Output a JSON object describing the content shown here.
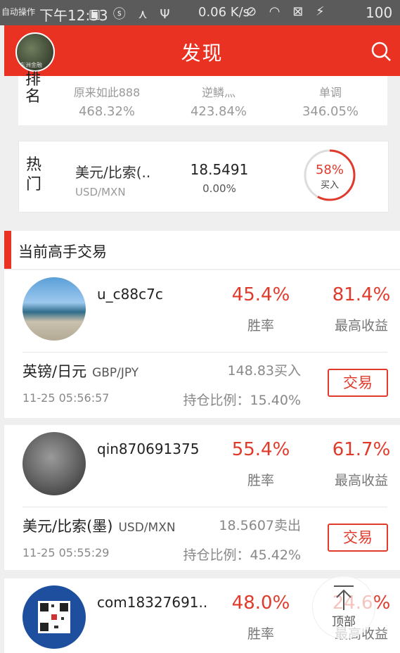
{
  "status_bar": {
    "left_text": "自动操作",
    "time": "下午12:53",
    "network_speed": "0.06 K/s",
    "battery": "100"
  },
  "app_bar": {
    "title": "发现",
    "avatar_caption": "东洲金融"
  },
  "ranking": {
    "label": "排名",
    "items": [
      {
        "name": "原来如此888",
        "pct": "468.32%"
      },
      {
        "name": "逆鳞灬",
        "pct": "423.84%"
      },
      {
        "name": "单调",
        "pct": "346.05%"
      }
    ]
  },
  "hot": {
    "label": "热门",
    "pair_name": "美元/比索(..",
    "pair_code": "USD/MXN",
    "price": "18.5491",
    "change": "0.00%",
    "ring_pct": "58%",
    "ring_fraction": 0.58,
    "ring_action": "买入"
  },
  "section": {
    "title": "当前高手交易"
  },
  "traders": [
    {
      "username": "u_c88c7c",
      "win_rate": "45.4%",
      "win_rate_label": "胜率",
      "best_return": "81.4%",
      "best_return_label": "最高收益",
      "pair": "英镑/日元",
      "pair_code": "GBP/JPY",
      "order": "148.83买入",
      "time": "11-25 05:56:57",
      "position_ratio": "持仓比例：15.40%",
      "button": "交易"
    },
    {
      "username": "qin870691375",
      "win_rate": "55.4%",
      "win_rate_label": "胜率",
      "best_return": "61.7%",
      "best_return_label": "最高收益",
      "pair": "美元/比索(墨)",
      "pair_code": "USD/MXN",
      "order": "18.5607卖出",
      "time": "11-25 05:55:29",
      "position_ratio": "持仓比例：45.42%",
      "button": "交易"
    },
    {
      "username": "com18327691..",
      "win_rate": "48.0%",
      "win_rate_label": "胜率",
      "best_return": "24.6%",
      "best_return_label": "最高收益"
    }
  ],
  "back_to_top": {
    "label": "顶部"
  },
  "colors": {
    "accent": "#ea3223",
    "positive": "#e03a2a"
  }
}
